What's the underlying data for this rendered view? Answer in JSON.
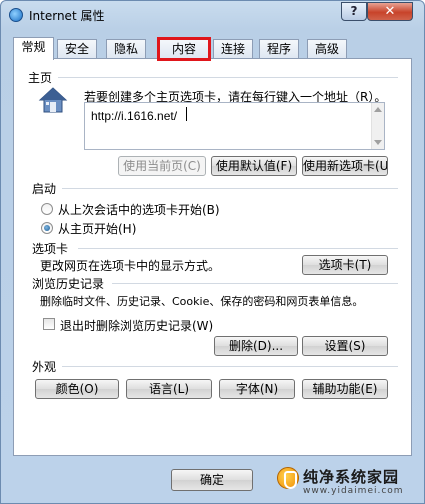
{
  "window": {
    "title": "Internet 属性",
    "help_symbol": "?",
    "close_symbol": "✕"
  },
  "tabs": [
    {
      "label": "常规",
      "active": true
    },
    {
      "label": "安全"
    },
    {
      "label": "隐私"
    },
    {
      "label": "内容",
      "highlighted": true
    },
    {
      "label": "连接"
    },
    {
      "label": "程序"
    },
    {
      "label": "高级"
    }
  ],
  "homepage": {
    "section_label": "主页",
    "description": "若要创建多个主页选项卡，请在每行键入一个地址（R）。",
    "url_value": "http://i.1616.net/",
    "use_current_label": "使用当前页(C)",
    "use_default_label": "使用默认值(F)",
    "use_new_tab_label": "使用新选项卡(U)"
  },
  "startup": {
    "section_label": "启动",
    "option_last_session": "从上次会话中的选项卡开始(B)",
    "option_homepage": "从主页开始(H)",
    "selected": "option_homepage"
  },
  "tabs_section": {
    "section_label": "选项卡",
    "description": "更改网页在选项卡中的显示方式。",
    "button_label": "选项卡(T)"
  },
  "history": {
    "section_label": "浏览历史记录",
    "description": "删除临时文件、历史记录、Cookie、保存的密码和网页表单信息。",
    "delete_on_exit_label": "退出时删除浏览历史记录(W)",
    "delete_on_exit_checked": false,
    "delete_button_label": "删除(D)...",
    "settings_button_label": "设置(S)"
  },
  "appearance": {
    "section_label": "外观",
    "colors_label": "颜色(O)",
    "languages_label": "语言(L)",
    "fonts_label": "字体(N)",
    "accessibility_label": "辅助功能(E)"
  },
  "footer": {
    "ok_label": "确定"
  },
  "watermark": {
    "title": "纯净系统家园",
    "url": "www.yidaimei.com"
  },
  "colors": {
    "highlight_border": "#e0161b",
    "close_button": "#c8432a"
  }
}
